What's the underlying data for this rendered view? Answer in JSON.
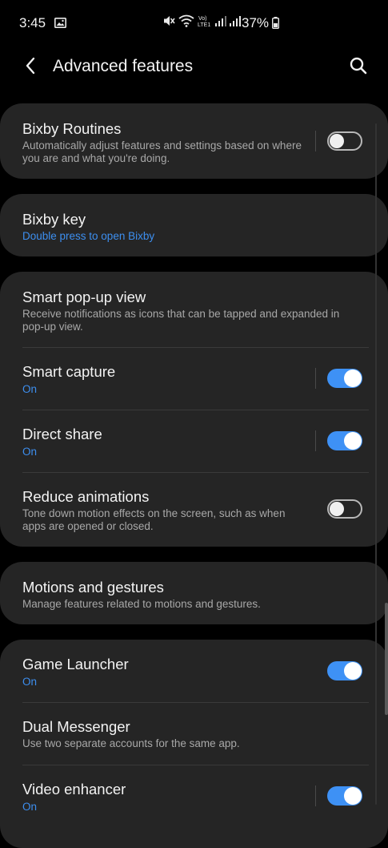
{
  "status_bar": {
    "time": "3:45",
    "battery": "37%",
    "icons": [
      "image-icon",
      "mute-icon",
      "wifi-icon",
      "volte-icon",
      "signal-icon",
      "signal-icon",
      "battery-icon"
    ]
  },
  "header": {
    "title": "Advanced features",
    "back_icon": "back-arrow-icon",
    "search_icon": "search-icon"
  },
  "colors": {
    "background": "#000000",
    "card": "#252525",
    "accent": "#3e91f5",
    "subtitle": "#a8a8a8",
    "on_text": "#3d8ff0"
  },
  "items": {
    "bixby_routines": {
      "title": "Bixby Routines",
      "subtitle": "Automatically adjust features and settings based on where you are and what you're doing.",
      "toggle": false
    },
    "bixby_key": {
      "title": "Bixby key",
      "subtitle": "Double press to open Bixby"
    },
    "smart_popup": {
      "title": "Smart pop-up view",
      "subtitle": "Receive notifications as icons that can be tapped and expanded in pop-up view."
    },
    "smart_capture": {
      "title": "Smart capture",
      "subtitle": "On",
      "toggle": true
    },
    "direct_share": {
      "title": "Direct share",
      "subtitle": "On",
      "toggle": true
    },
    "reduce_animations": {
      "title": "Reduce animations",
      "subtitle": "Tone down motion effects on the screen, such as when apps are opened or closed.",
      "toggle": false
    },
    "motions_gestures": {
      "title": "Motions and gestures",
      "subtitle": "Manage features related to motions and gestures."
    },
    "game_launcher": {
      "title": "Game Launcher",
      "subtitle": "On",
      "toggle": true
    },
    "dual_messenger": {
      "title": "Dual Messenger",
      "subtitle": "Use two separate accounts for the same app."
    },
    "video_enhancer": {
      "title": "Video enhancer",
      "subtitle": "On",
      "toggle": true
    }
  }
}
